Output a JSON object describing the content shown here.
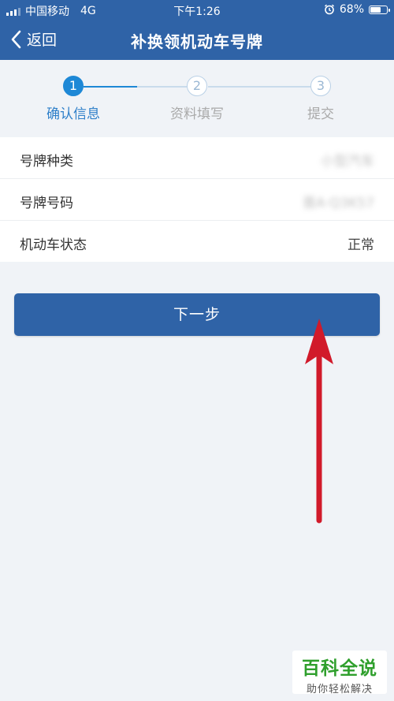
{
  "status_bar": {
    "carrier": "中国移动",
    "network": "4G",
    "time": "下午1:26",
    "battery": "68%",
    "battery_level": 0.68
  },
  "nav": {
    "back_label": "返回",
    "title": "补换领机动车号牌"
  },
  "steps": [
    {
      "number": "1",
      "label": "确认信息",
      "active": true
    },
    {
      "number": "2",
      "label": "资料填写",
      "active": false
    },
    {
      "number": "3",
      "label": "提交",
      "active": false
    }
  ],
  "info": [
    {
      "key": "号牌种类",
      "value": "小型汽车"
    },
    {
      "key": "号牌号码",
      "value": "晋A·Q3K57"
    },
    {
      "key": "机动车状态",
      "value": "正常"
    }
  ],
  "next_button": "下一步",
  "watermark": {
    "title": "百科全说",
    "subtitle": "助你轻松解决"
  },
  "colors": {
    "primary": "#2f63a7",
    "step_active": "#1e88d6",
    "arrow": "#d11a2a",
    "watermark_green": "#2f9f2c"
  }
}
